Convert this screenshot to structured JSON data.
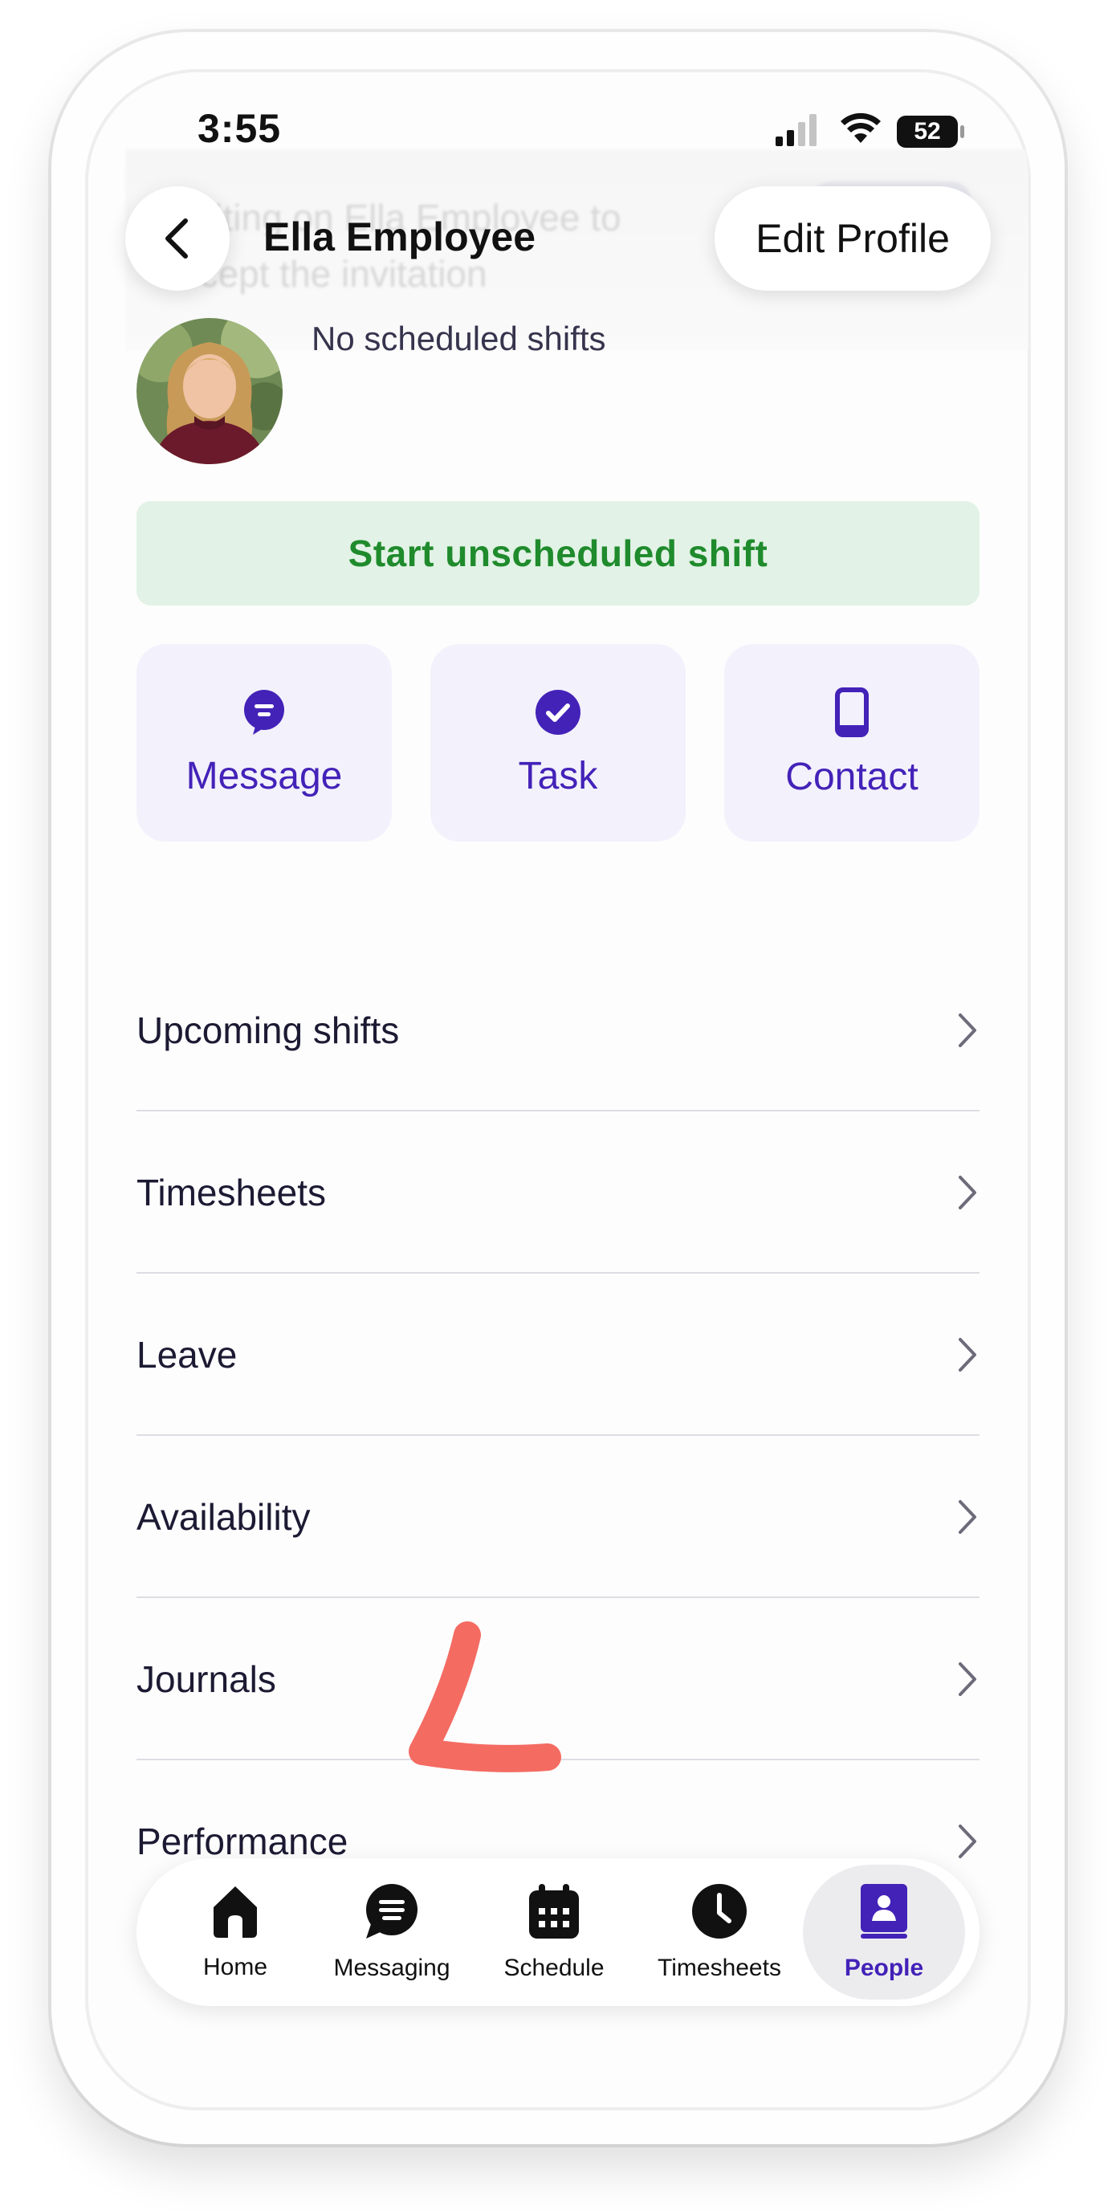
{
  "status_bar": {
    "time": "3:55",
    "battery": "52"
  },
  "banner": {
    "line1": "Waiting on Ella Employee to",
    "line2": "accept the invitation"
  },
  "header": {
    "title": "Ella Employee",
    "edit_label": "Edit Profile"
  },
  "profile": {
    "shift_status": "No scheduled shifts"
  },
  "start_shift_label": "Start unscheduled shift",
  "quick_actions": [
    {
      "label": "Message",
      "icon": "message-icon"
    },
    {
      "label": "Task",
      "icon": "check-circle-icon"
    },
    {
      "label": "Contact",
      "icon": "phone-icon"
    }
  ],
  "menu": [
    {
      "label": "Upcoming shifts"
    },
    {
      "label": "Timesheets"
    },
    {
      "label": "Leave"
    },
    {
      "label": "Availability"
    },
    {
      "label": "Journals"
    },
    {
      "label": "Performance"
    }
  ],
  "tabs": [
    {
      "label": "Home",
      "icon": "home-icon"
    },
    {
      "label": "Messaging",
      "icon": "chat-icon"
    },
    {
      "label": "Schedule",
      "icon": "calendar-icon"
    },
    {
      "label": "Timesheets",
      "icon": "clock-icon"
    },
    {
      "label": "People",
      "icon": "person-book-icon",
      "active": true
    }
  ],
  "colors": {
    "accent": "#4322b8",
    "success_bg": "#e2f2e6",
    "success_text": "#1f8b2c",
    "card_bg": "#f3f1fc",
    "annotation": "#f46b62"
  }
}
